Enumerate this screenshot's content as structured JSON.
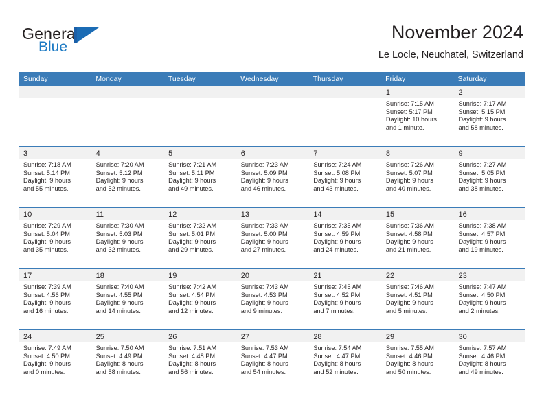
{
  "brand": {
    "name_part1": "General",
    "name_part2": "Blue",
    "accent_color": "#1b6cb5",
    "flag_icon": "triangle-flag-icon"
  },
  "header": {
    "title": "November 2024",
    "subtitle": "Le Locle, Neuchatel, Switzerland"
  },
  "calendar": {
    "header_bg": "#3b7cb8",
    "date_band_bg": "#f1f1f1",
    "weekdays": [
      "Sunday",
      "Monday",
      "Tuesday",
      "Wednesday",
      "Thursday",
      "Friday",
      "Saturday"
    ],
    "weeks": [
      [
        {
          "date": "",
          "lines": []
        },
        {
          "date": "",
          "lines": []
        },
        {
          "date": "",
          "lines": []
        },
        {
          "date": "",
          "lines": []
        },
        {
          "date": "",
          "lines": []
        },
        {
          "date": "1",
          "lines": [
            "Sunrise: 7:15 AM",
            "Sunset: 5:17 PM",
            "Daylight: 10 hours",
            "and 1 minute."
          ]
        },
        {
          "date": "2",
          "lines": [
            "Sunrise: 7:17 AM",
            "Sunset: 5:15 PM",
            "Daylight: 9 hours",
            "and 58 minutes."
          ]
        }
      ],
      [
        {
          "date": "3",
          "lines": [
            "Sunrise: 7:18 AM",
            "Sunset: 5:14 PM",
            "Daylight: 9 hours",
            "and 55 minutes."
          ]
        },
        {
          "date": "4",
          "lines": [
            "Sunrise: 7:20 AM",
            "Sunset: 5:12 PM",
            "Daylight: 9 hours",
            "and 52 minutes."
          ]
        },
        {
          "date": "5",
          "lines": [
            "Sunrise: 7:21 AM",
            "Sunset: 5:11 PM",
            "Daylight: 9 hours",
            "and 49 minutes."
          ]
        },
        {
          "date": "6",
          "lines": [
            "Sunrise: 7:23 AM",
            "Sunset: 5:09 PM",
            "Daylight: 9 hours",
            "and 46 minutes."
          ]
        },
        {
          "date": "7",
          "lines": [
            "Sunrise: 7:24 AM",
            "Sunset: 5:08 PM",
            "Daylight: 9 hours",
            "and 43 minutes."
          ]
        },
        {
          "date": "8",
          "lines": [
            "Sunrise: 7:26 AM",
            "Sunset: 5:07 PM",
            "Daylight: 9 hours",
            "and 40 minutes."
          ]
        },
        {
          "date": "9",
          "lines": [
            "Sunrise: 7:27 AM",
            "Sunset: 5:05 PM",
            "Daylight: 9 hours",
            "and 38 minutes."
          ]
        }
      ],
      [
        {
          "date": "10",
          "lines": [
            "Sunrise: 7:29 AM",
            "Sunset: 5:04 PM",
            "Daylight: 9 hours",
            "and 35 minutes."
          ]
        },
        {
          "date": "11",
          "lines": [
            "Sunrise: 7:30 AM",
            "Sunset: 5:03 PM",
            "Daylight: 9 hours",
            "and 32 minutes."
          ]
        },
        {
          "date": "12",
          "lines": [
            "Sunrise: 7:32 AM",
            "Sunset: 5:01 PM",
            "Daylight: 9 hours",
            "and 29 minutes."
          ]
        },
        {
          "date": "13",
          "lines": [
            "Sunrise: 7:33 AM",
            "Sunset: 5:00 PM",
            "Daylight: 9 hours",
            "and 27 minutes."
          ]
        },
        {
          "date": "14",
          "lines": [
            "Sunrise: 7:35 AM",
            "Sunset: 4:59 PM",
            "Daylight: 9 hours",
            "and 24 minutes."
          ]
        },
        {
          "date": "15",
          "lines": [
            "Sunrise: 7:36 AM",
            "Sunset: 4:58 PM",
            "Daylight: 9 hours",
            "and 21 minutes."
          ]
        },
        {
          "date": "16",
          "lines": [
            "Sunrise: 7:38 AM",
            "Sunset: 4:57 PM",
            "Daylight: 9 hours",
            "and 19 minutes."
          ]
        }
      ],
      [
        {
          "date": "17",
          "lines": [
            "Sunrise: 7:39 AM",
            "Sunset: 4:56 PM",
            "Daylight: 9 hours",
            "and 16 minutes."
          ]
        },
        {
          "date": "18",
          "lines": [
            "Sunrise: 7:40 AM",
            "Sunset: 4:55 PM",
            "Daylight: 9 hours",
            "and 14 minutes."
          ]
        },
        {
          "date": "19",
          "lines": [
            "Sunrise: 7:42 AM",
            "Sunset: 4:54 PM",
            "Daylight: 9 hours",
            "and 12 minutes."
          ]
        },
        {
          "date": "20",
          "lines": [
            "Sunrise: 7:43 AM",
            "Sunset: 4:53 PM",
            "Daylight: 9 hours",
            "and 9 minutes."
          ]
        },
        {
          "date": "21",
          "lines": [
            "Sunrise: 7:45 AM",
            "Sunset: 4:52 PM",
            "Daylight: 9 hours",
            "and 7 minutes."
          ]
        },
        {
          "date": "22",
          "lines": [
            "Sunrise: 7:46 AM",
            "Sunset: 4:51 PM",
            "Daylight: 9 hours",
            "and 5 minutes."
          ]
        },
        {
          "date": "23",
          "lines": [
            "Sunrise: 7:47 AM",
            "Sunset: 4:50 PM",
            "Daylight: 9 hours",
            "and 2 minutes."
          ]
        }
      ],
      [
        {
          "date": "24",
          "lines": [
            "Sunrise: 7:49 AM",
            "Sunset: 4:50 PM",
            "Daylight: 9 hours",
            "and 0 minutes."
          ]
        },
        {
          "date": "25",
          "lines": [
            "Sunrise: 7:50 AM",
            "Sunset: 4:49 PM",
            "Daylight: 8 hours",
            "and 58 minutes."
          ]
        },
        {
          "date": "26",
          "lines": [
            "Sunrise: 7:51 AM",
            "Sunset: 4:48 PM",
            "Daylight: 8 hours",
            "and 56 minutes."
          ]
        },
        {
          "date": "27",
          "lines": [
            "Sunrise: 7:53 AM",
            "Sunset: 4:47 PM",
            "Daylight: 8 hours",
            "and 54 minutes."
          ]
        },
        {
          "date": "28",
          "lines": [
            "Sunrise: 7:54 AM",
            "Sunset: 4:47 PM",
            "Daylight: 8 hours",
            "and 52 minutes."
          ]
        },
        {
          "date": "29",
          "lines": [
            "Sunrise: 7:55 AM",
            "Sunset: 4:46 PM",
            "Daylight: 8 hours",
            "and 50 minutes."
          ]
        },
        {
          "date": "30",
          "lines": [
            "Sunrise: 7:57 AM",
            "Sunset: 4:46 PM",
            "Daylight: 8 hours",
            "and 49 minutes."
          ]
        }
      ]
    ]
  }
}
